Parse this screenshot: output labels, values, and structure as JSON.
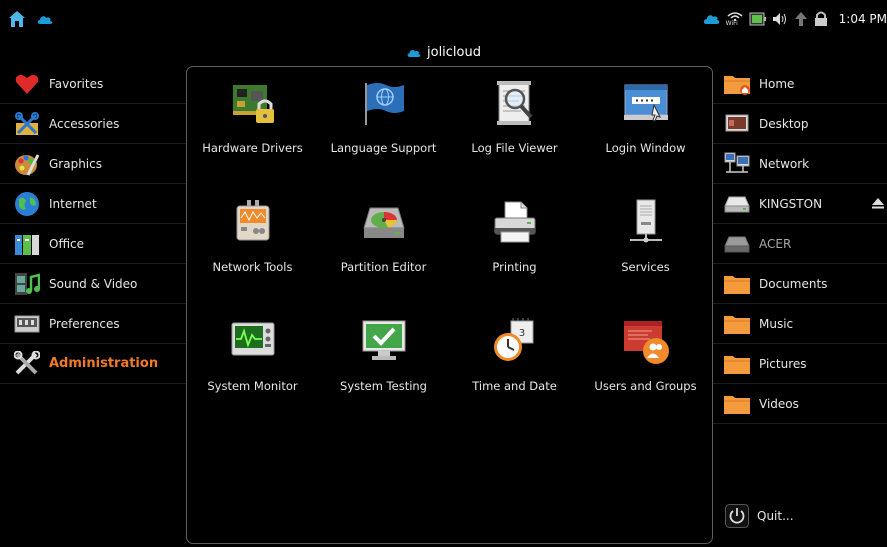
{
  "topbar": {
    "clock": "1:04 PM",
    "wifi_label": "WiFi"
  },
  "brand": {
    "name": "jolicloud"
  },
  "sidebar": {
    "items": [
      {
        "label": "Favorites",
        "icon": "heart-icon"
      },
      {
        "label": "Accessories",
        "icon": "accessories-icon"
      },
      {
        "label": "Graphics",
        "icon": "graphics-icon"
      },
      {
        "label": "Internet",
        "icon": "globe-icon"
      },
      {
        "label": "Office",
        "icon": "office-icon"
      },
      {
        "label": "Sound & Video",
        "icon": "film-icon"
      },
      {
        "label": "Preferences",
        "icon": "preferences-icon"
      },
      {
        "label": "Administration",
        "icon": "tools-icon",
        "active": true
      }
    ]
  },
  "apps": [
    {
      "label": "Hardware Drivers",
      "icon": "hardware-drivers-icon"
    },
    {
      "label": "Language Support",
      "icon": "language-support-icon"
    },
    {
      "label": "Log File Viewer",
      "icon": "log-file-viewer-icon"
    },
    {
      "label": "Login Window",
      "icon": "login-window-icon"
    },
    {
      "label": "Network Tools",
      "icon": "network-tools-icon"
    },
    {
      "label": "Partition Editor",
      "icon": "partition-editor-icon"
    },
    {
      "label": "Printing",
      "icon": "printer-icon"
    },
    {
      "label": "Services",
      "icon": "services-icon"
    },
    {
      "label": "System Monitor",
      "icon": "system-monitor-icon"
    },
    {
      "label": "System Testing",
      "icon": "system-testing-icon"
    },
    {
      "label": "Time and Date",
      "icon": "clock-icon"
    },
    {
      "label": "Users and Groups",
      "icon": "users-groups-icon"
    }
  ],
  "places": [
    {
      "label": "Home",
      "icon": "home-folder-icon"
    },
    {
      "label": "Desktop",
      "icon": "desktop-icon"
    },
    {
      "label": "Network",
      "icon": "network-icon"
    },
    {
      "label": "KINGSTON",
      "icon": "drive-icon",
      "eject": true
    },
    {
      "label": "ACER",
      "icon": "drive-icon",
      "dim": true
    },
    {
      "label": "Documents",
      "icon": "folder-icon"
    },
    {
      "label": "Music",
      "icon": "folder-icon"
    },
    {
      "label": "Pictures",
      "icon": "folder-icon"
    },
    {
      "label": "Videos",
      "icon": "folder-icon"
    }
  ],
  "quit": {
    "label": "Quit..."
  },
  "colors": {
    "accent": "#f07a26",
    "cloud": "#1e9ad6",
    "panel_border": "#5d5d5d",
    "folder": "#f39a3c"
  }
}
